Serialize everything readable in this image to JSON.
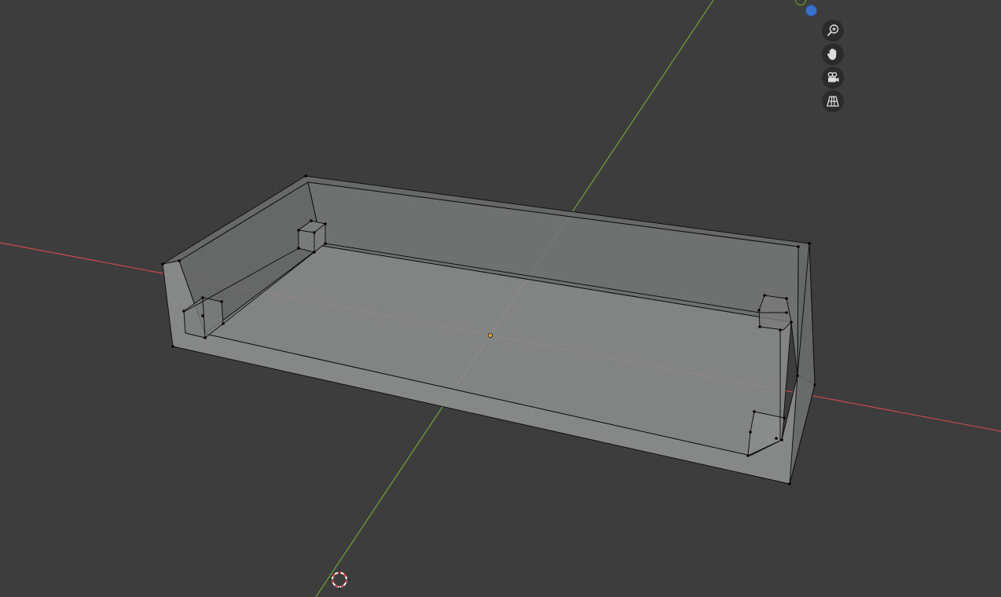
{
  "viewport": {
    "background": "#3d3d3d",
    "x_axis_color": "#c9494f",
    "y_axis_color": "#6a9a3a",
    "mesh_face_color": "#8a8b8b",
    "mesh_edge_color": "#111111",
    "origin_color": "#f0a030",
    "cursor_colors": [
      "#e04040",
      "#ffffff"
    ]
  },
  "gizmo": {
    "y_axis_color": "#6aab2a",
    "z_axis_color": "#3b6fcc"
  },
  "nav_tools": [
    {
      "name": "zoom",
      "icon": "zoom-in-icon"
    },
    {
      "name": "pan",
      "icon": "hand-icon"
    },
    {
      "name": "camera",
      "icon": "camera-icon"
    },
    {
      "name": "ortho",
      "icon": "grid-icon"
    }
  ]
}
